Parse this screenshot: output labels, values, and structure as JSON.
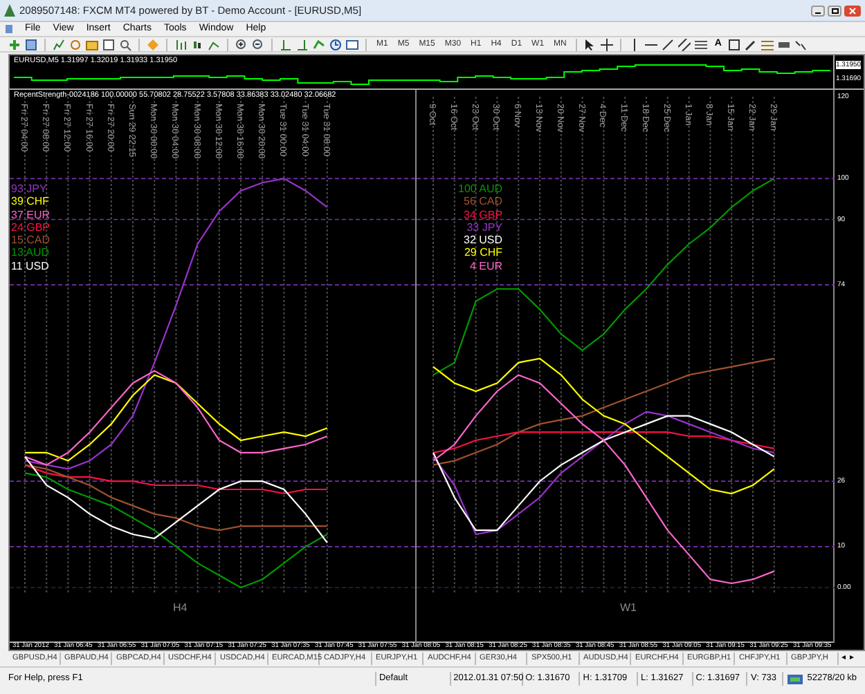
{
  "window": {
    "title": "2089507148: FXCM MT4 powered by BT - Demo Account - [EURUSD,M5]"
  },
  "menu": [
    "File",
    "View",
    "Insert",
    "Charts",
    "Tools",
    "Window",
    "Help"
  ],
  "toolbar": {
    "timeframes": [
      "M1",
      "M5",
      "M15",
      "M30",
      "H1",
      "H4",
      "D1",
      "W1",
      "MN"
    ],
    "text_tool": "A"
  },
  "price_chart": {
    "header": "EURUSD,M5  1.31997 1.32019 1.31933 1.31950",
    "price_labels": [
      {
        "text": "1.31950",
        "current": true
      },
      {
        "text": "1.31690",
        "current": false
      }
    ]
  },
  "indicator": {
    "header": "RecentStrength-0024186 100.00000 55.70802 28.75522 3.57808 33.86383 33.02480 32.06682",
    "charts": [
      {
        "chart_data": {
          "type": "line",
          "title": "H4",
          "grid": true,
          "categories": [
            "Fri 27 04:00",
            "Fri 27 08:00",
            "Fri 27 12:00",
            "Fri 27 16:00",
            "Fri 27 20:00",
            "Sun 29 22:15",
            "Mon 30 00:00",
            "Mon 30 04:00",
            "Mon 30 08:00",
            "Mon 30 12:00",
            "Mon 30 16:00",
            "Mon 30 20:00",
            "Tue 31 00:00",
            "Tue 31 04:00",
            "Tue 31 08:00"
          ],
          "ylim": [
            0,
            120
          ],
          "series": [
            {
              "name": "93 JPY",
              "color": "#9933cc",
              "values": [
                31,
                30,
                29,
                31,
                35,
                42,
                55,
                69,
                84,
                92,
                97,
                99,
                100,
                97,
                93
              ]
            },
            {
              "name": "39 CHF",
              "color": "#ffff00",
              "values": [
                33,
                33,
                31,
                35,
                40,
                47,
                52,
                50,
                45,
                40,
                36,
                37,
                38,
                37,
                39
              ]
            },
            {
              "name": "37 EUR",
              "color": "#ff66cc",
              "values": [
                32,
                30,
                33,
                38,
                44,
                50,
                53,
                50,
                44,
                36,
                33,
                33,
                34,
                35,
                37
              ]
            },
            {
              "name": "24 GBP",
              "color": "#ff1144",
              "values": [
                30,
                28,
                27,
                27,
                26,
                26,
                25,
                25,
                25,
                24,
                24,
                24,
                23,
                24,
                24
              ]
            },
            {
              "name": "15 CAD",
              "color": "#a0522d",
              "values": [
                30,
                29,
                27,
                25,
                22,
                20,
                18,
                17,
                15,
                14,
                15,
                15,
                15,
                15,
                15
              ]
            },
            {
              "name": "13 AUD",
              "color": "#009900",
              "values": [
                28,
                27,
                24,
                22,
                20,
                17,
                14,
                10,
                6,
                3,
                0,
                2,
                6,
                10,
                13
              ]
            },
            {
              "name": "11 USD",
              "color": "#ffffff",
              "values": [
                32,
                25,
                22,
                18,
                15,
                13,
                12,
                16,
                20,
                24,
                26,
                26,
                24,
                18,
                11
              ]
            }
          ]
        }
      },
      {
        "chart_data": {
          "type": "line",
          "title": "W1",
          "grid": true,
          "categories": [
            "9 Oct",
            "16 Oct",
            "23 Oct",
            "30 Oct",
            "6 Nov",
            "13 Nov",
            "20 Nov",
            "27 Nov",
            "4 Dec",
            "11 Dec",
            "18 Dec",
            "25 Dec",
            "1 Jan",
            "8 Jan",
            "15 Jan",
            "22 Jan",
            "29 Jan"
          ],
          "ylim": [
            0,
            120
          ],
          "yticks": [
            {
              "value": 120,
              "label": "120"
            },
            100,
            90,
            74,
            26,
            10,
            {
              "value": 0,
              "label": "0.00"
            }
          ],
          "series": [
            {
              "name": "100 AUD",
              "color": "#009900",
              "values": [
                52,
                55,
                70,
                73,
                73,
                68,
                62,
                58,
                62,
                68,
                73,
                79,
                84,
                88,
                93,
                97,
                100
              ]
            },
            {
              "name": "56 CAD",
              "color": "#a0522d",
              "values": [
                30,
                31,
                33,
                35,
                38,
                40,
                41,
                42,
                44,
                46,
                48,
                50,
                52,
                53,
                54,
                55,
                56
              ]
            },
            {
              "name": "34 GBP",
              "color": "#ff1144",
              "values": [
                33,
                34,
                36,
                37,
                38,
                38,
                38,
                38,
                38,
                38,
                38,
                38,
                37,
                37,
                36,
                35,
                34
              ]
            },
            {
              "name": "33 JPY",
              "color": "#9933cc",
              "values": [
                32,
                25,
                13,
                14,
                18,
                22,
                28,
                32,
                36,
                40,
                43,
                42,
                40,
                38,
                36,
                34,
                33
              ]
            },
            {
              "name": "32 USD",
              "color": "#ffffff",
              "values": [
                33,
                22,
                14,
                14,
                20,
                26,
                30,
                33,
                36,
                38,
                40,
                42,
                42,
                40,
                38,
                35,
                32
              ]
            },
            {
              "name": "29 CHF",
              "color": "#ffff00",
              "values": [
                54,
                50,
                48,
                50,
                55,
                56,
                52,
                46,
                42,
                40,
                36,
                32,
                28,
                24,
                23,
                25,
                29
              ]
            },
            {
              "name": "4 EUR",
              "color": "#ff66cc",
              "values": [
                31,
                35,
                42,
                48,
                52,
                50,
                45,
                40,
                36,
                30,
                22,
                14,
                8,
                2,
                1,
                2,
                4
              ]
            }
          ]
        }
      }
    ]
  },
  "time_axis": [
    "31 Jan 2012",
    "31 Jan 06:45",
    "31 Jan 06:55",
    "31 Jan 07:05",
    "31 Jan 07:15",
    "31 Jan 07:25",
    "31 Jan 07:35",
    "31 Jan 07:45",
    "31 Jan 07:55",
    "31 Jan 08:05",
    "31 Jan 08:15",
    "31 Jan 08:25",
    "31 Jan 08:35",
    "31 Jan 08:45",
    "31 Jan 08:55",
    "31 Jan 09:05",
    "31 Jan 09:15",
    "31 Jan 09:25",
    "31 Jan 09:35"
  ],
  "tabs": [
    "GBPUSD,H4",
    "GBPAUD,H4",
    "GBPCAD,H4",
    "USDCHF,H4",
    "USDCAD,H4",
    "EURCAD,M15",
    "CADJPY,H4",
    "EURJPY,H1",
    "AUDCHF,H4",
    "GER30,H4",
    "SPX500,H1",
    "AUDUSD,H4",
    "EURCHF,H4",
    "EURGBP,H1",
    "CHFJPY,H1",
    "GBPJPY,H"
  ],
  "tab_scroll": [
    "◂",
    "▸"
  ],
  "status_bar": {
    "help": "For Help, press F1",
    "profile": "Default",
    "time": "2012.01.31 07:50",
    "open": "O: 1.31670",
    "high": "H: 1.31709",
    "low": "L: 1.31627",
    "close": "C: 1.31697",
    "volume": "V: 733",
    "traffic": "52278/20 kb"
  }
}
